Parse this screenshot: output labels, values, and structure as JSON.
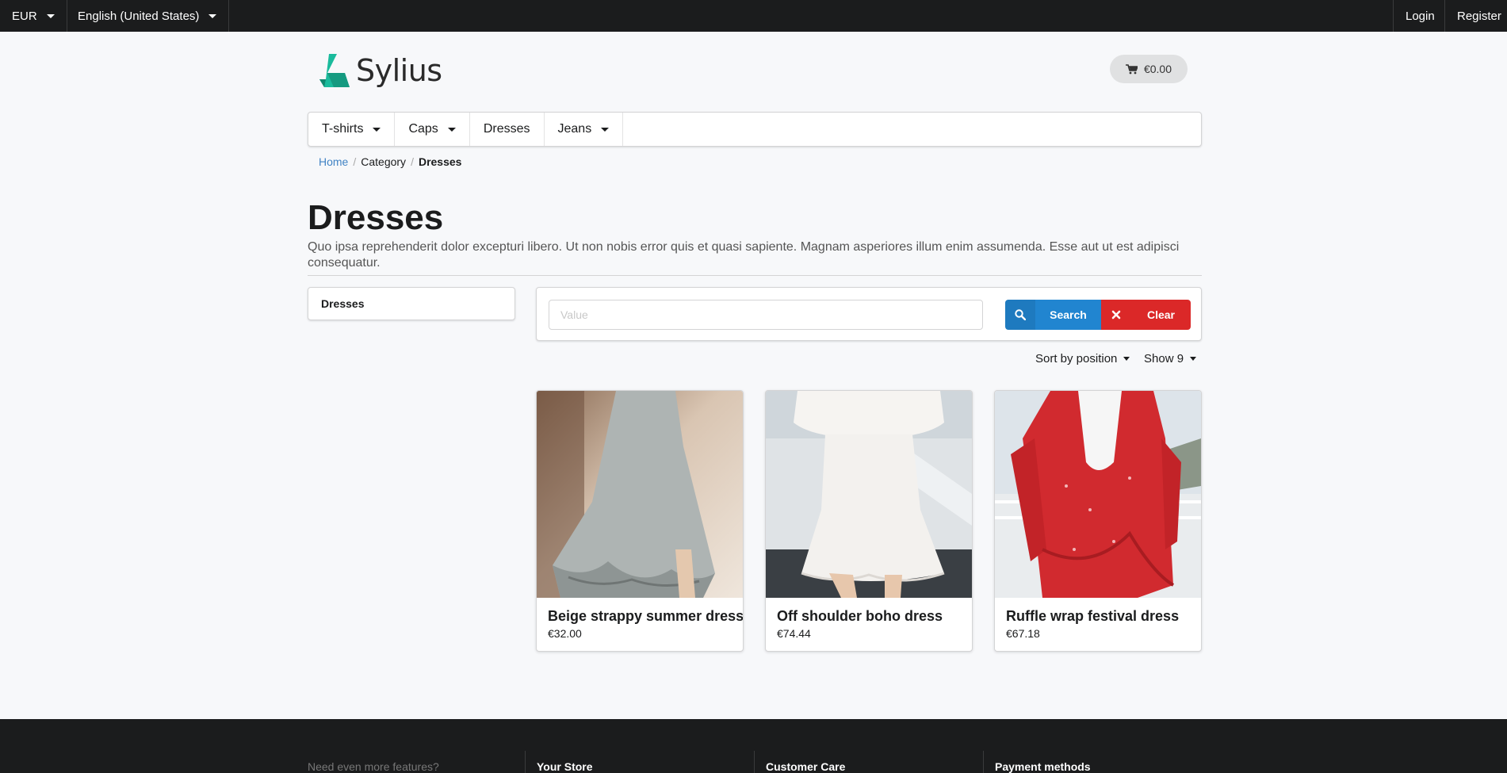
{
  "topbar": {
    "currency": "EUR",
    "locale": "English (United States)",
    "login": "Login",
    "register": "Register"
  },
  "header": {
    "logo_text": "Sylius",
    "cart_total": "€0.00"
  },
  "menu": [
    {
      "label": "T-shirts",
      "has_dropdown": true
    },
    {
      "label": "Caps",
      "has_dropdown": true
    },
    {
      "label": "Dresses",
      "has_dropdown": false
    },
    {
      "label": "Jeans",
      "has_dropdown": true
    }
  ],
  "breadcrumb": {
    "home": "Home",
    "category": "Category",
    "current": "Dresses"
  },
  "page": {
    "title": "Dresses",
    "description": "Quo ipsa reprehenderit dolor excepturi libero. Ut non nobis error quis et quasi sapiente. Magnam asperiores illum enim assumenda. Esse aut ut est adipisci consequatur."
  },
  "sidebar": {
    "taxon": "Dresses"
  },
  "filter": {
    "placeholder": "Value",
    "search_label": "Search",
    "clear_label": "Clear"
  },
  "sorting": {
    "sort_label": "Sort by position",
    "show_label": "Show 9"
  },
  "products": [
    {
      "name": "Beige strappy summer dress",
      "price": "€32.00"
    },
    {
      "name": "Off shoulder boho dress",
      "price": "€74.44"
    },
    {
      "name": "Ruffle wrap festival dress",
      "price": "€67.18"
    }
  ],
  "footer": {
    "features": "Need even more features?",
    "store": "Your Store",
    "care": "Customer Care",
    "payment": "Payment methods"
  },
  "colors": {
    "primary": "#2185d0",
    "danger": "#db2828",
    "brand": "#1abb9c",
    "dark": "#1b1c1d"
  }
}
